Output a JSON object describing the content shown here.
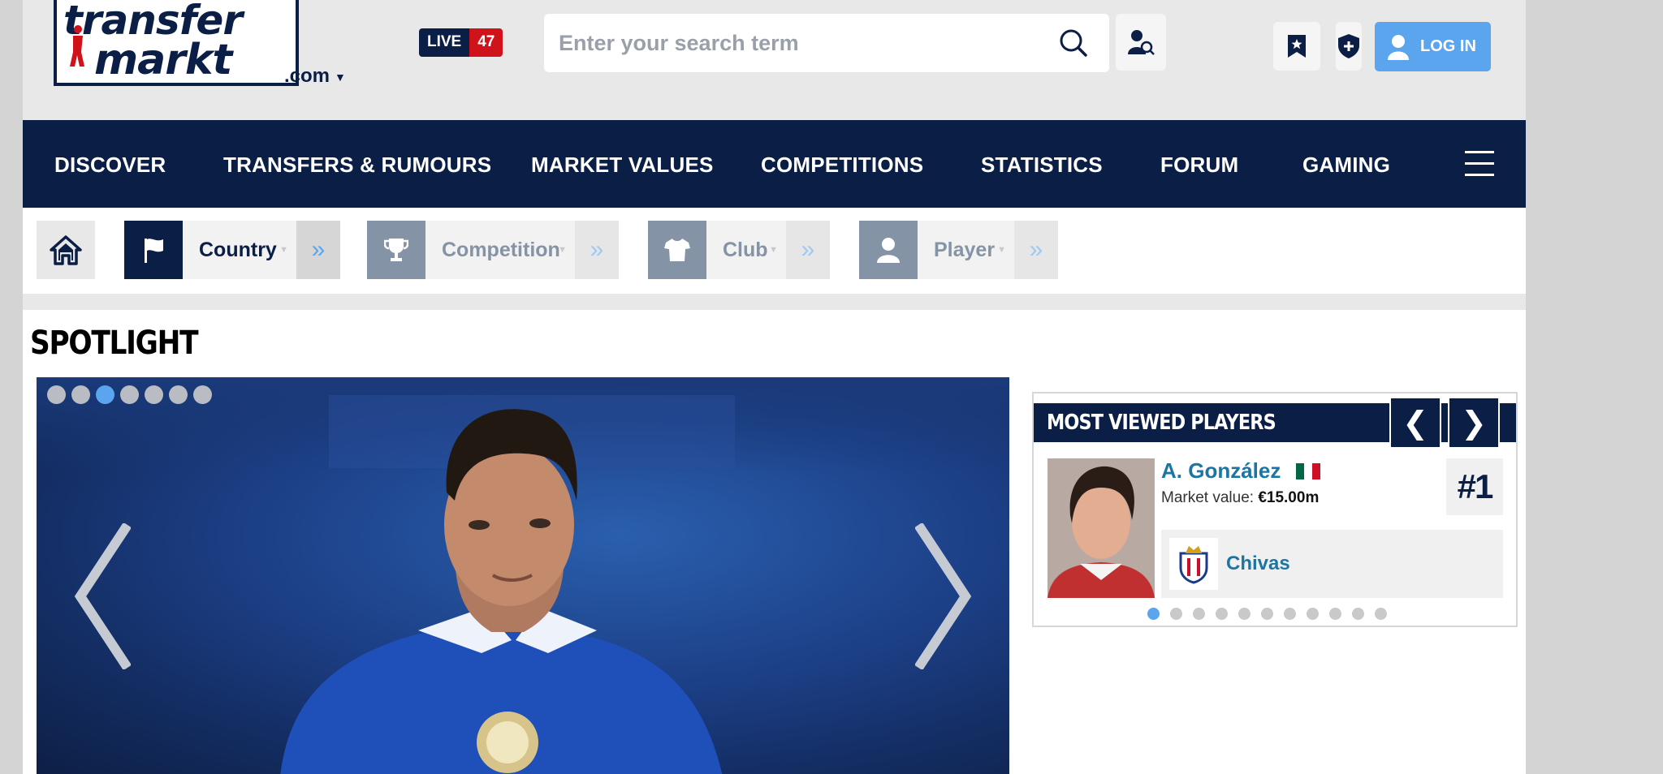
{
  "header": {
    "logo_line1": "transfer",
    "logo_line2": "markt",
    "domain": ".com",
    "live_label": "LIVE",
    "live_count": "47",
    "search_placeholder": "Enter your search term",
    "login_label": "LOG IN"
  },
  "nav": {
    "items": [
      "DISCOVER",
      "TRANSFERS & RUMOURS",
      "MARKET VALUES",
      "COMPETITIONS",
      "STATISTICS",
      "FORUM",
      "GAMING"
    ]
  },
  "filters": {
    "country": "Country",
    "competition": "Competition",
    "club": "Club",
    "player": "Player"
  },
  "spotlight": {
    "title": "SPOTLIGHT",
    "slide_count": 7,
    "active_slide": 3
  },
  "most_viewed": {
    "title": "MOST VIEWED PLAYERS",
    "prev_glyph": "❮",
    "next_glyph": "❯",
    "player_name": "A. González",
    "market_value_label": "Market value:",
    "market_value": "€15.00m",
    "rank": "#1",
    "club": "Chivas",
    "dot_count": 11,
    "active_dot": 1
  },
  "colors": {
    "navy": "#0b1e45",
    "accent_blue": "#5ba5ef",
    "live_red": "#d0121a",
    "link_blue": "#1d75a3"
  }
}
